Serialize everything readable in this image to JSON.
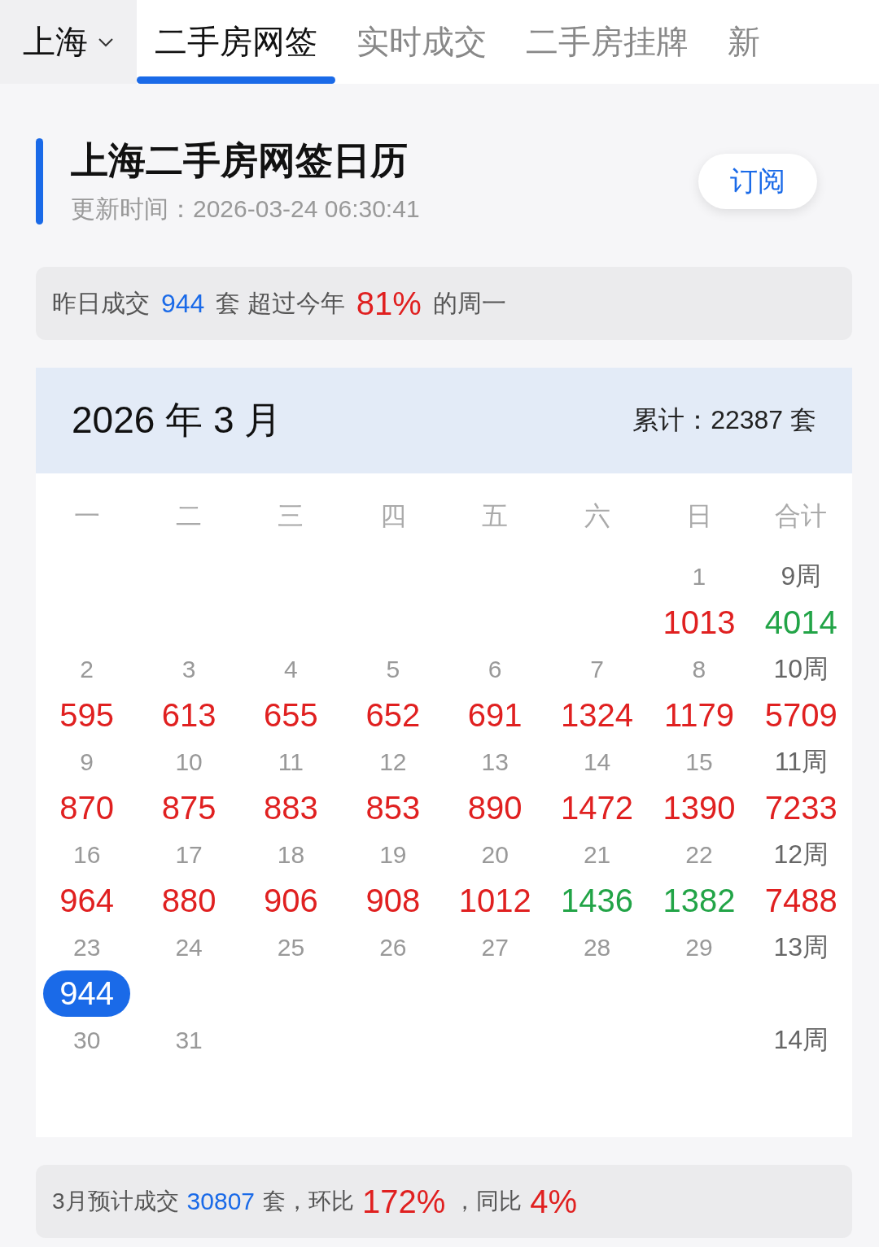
{
  "tabs": [
    {
      "label": "上海",
      "kind": "city",
      "selected": false
    },
    {
      "label": "二手房网签",
      "kind": "tab",
      "selected": true
    },
    {
      "label": "实时成交",
      "kind": "tab",
      "selected": false
    },
    {
      "label": "二手房挂牌",
      "kind": "tab",
      "selected": false
    },
    {
      "label": "新",
      "kind": "tab",
      "selected": false
    }
  ],
  "header": {
    "title": "上海二手房网签日历",
    "updated": "更新时间：2026-03-24 06:30:41",
    "subscribe": "订阅"
  },
  "summary": [
    {
      "text": "昨日成交",
      "kind": "plain"
    },
    {
      "text": "944",
      "kind": "count"
    },
    {
      "text": "套 超过今年",
      "kind": "plain"
    },
    {
      "text": "81%",
      "kind": "percent"
    },
    {
      "text": "的周一",
      "kind": "plain"
    }
  ],
  "calendar": {
    "month": "2026 年 3 月",
    "total": "累计：22387 套",
    "weekdays": [
      "一",
      "二",
      "三",
      "四",
      "五",
      "六",
      "日",
      "合计"
    ],
    "weeks": [
      {
        "kind": "first",
        "days": [
          {
            "date": "1",
            "value": "1013",
            "color": "#e02020",
            "selected": false
          }
        ],
        "week": {
          "label": "9周",
          "value": "4014",
          "color": "#22a447"
        }
      },
      {
        "kind": "full",
        "days": [
          {
            "date": "2",
            "value": "595",
            "color": "#e02020",
            "selected": false
          },
          {
            "date": "3",
            "value": "613",
            "color": "#e02020",
            "selected": false
          },
          {
            "date": "4",
            "value": "655",
            "color": "#e02020",
            "selected": false
          },
          {
            "date": "5",
            "value": "652",
            "color": "#e02020",
            "selected": false
          },
          {
            "date": "6",
            "value": "691",
            "color": "#e02020",
            "selected": false
          },
          {
            "date": "7",
            "value": "1324",
            "color": "#e02020",
            "selected": false
          },
          {
            "date": "8",
            "value": "1179",
            "color": "#e02020",
            "selected": false
          }
        ],
        "week": {
          "label": "10周",
          "value": "5709",
          "color": "#e02020"
        }
      },
      {
        "kind": "full",
        "days": [
          {
            "date": "9",
            "value": "870",
            "color": "#e02020",
            "selected": false
          },
          {
            "date": "10",
            "value": "875",
            "color": "#e02020",
            "selected": false
          },
          {
            "date": "11",
            "value": "883",
            "color": "#e02020",
            "selected": false
          },
          {
            "date": "12",
            "value": "853",
            "color": "#e02020",
            "selected": false
          },
          {
            "date": "13",
            "value": "890",
            "color": "#e02020",
            "selected": false
          },
          {
            "date": "14",
            "value": "1472",
            "color": "#e02020",
            "selected": false
          },
          {
            "date": "15",
            "value": "1390",
            "color": "#e02020",
            "selected": false
          }
        ],
        "week": {
          "label": "11周",
          "value": "7233",
          "color": "#e02020"
        }
      },
      {
        "kind": "full",
        "days": [
          {
            "date": "16",
            "value": "964",
            "color": "#e02020",
            "selected": false
          },
          {
            "date": "17",
            "value": "880",
            "color": "#e02020",
            "selected": false
          },
          {
            "date": "18",
            "value": "906",
            "color": "#e02020",
            "selected": false
          },
          {
            "date": "19",
            "value": "908",
            "color": "#e02020",
            "selected": false
          },
          {
            "date": "20",
            "value": "1012",
            "color": "#e02020",
            "selected": false
          },
          {
            "date": "21",
            "value": "1436",
            "color": "#22a447",
            "selected": false
          },
          {
            "date": "22",
            "value": "1382",
            "color": "#22a447",
            "selected": false
          }
        ],
        "week": {
          "label": "12周",
          "value": "7488",
          "color": "#e02020"
        }
      },
      {
        "kind": "full",
        "days": [
          {
            "date": "23",
            "value": "944",
            "selected": true
          },
          {
            "date": "24"
          },
          {
            "date": "25"
          },
          {
            "date": "26"
          },
          {
            "date": "27"
          },
          {
            "date": "28"
          },
          {
            "date": "29"
          }
        ],
        "week": {
          "label": "13周"
        }
      },
      {
        "kind": "last",
        "days": [
          {
            "date": "30"
          },
          {
            "date": "31"
          }
        ],
        "week": {
          "label": "14周"
        }
      }
    ]
  },
  "forecast": [
    {
      "text": "3月预计成交",
      "kind": "plain"
    },
    {
      "text": "30807",
      "kind": "count"
    },
    {
      "text": "套，环比",
      "kind": "plain"
    },
    {
      "text": "172%",
      "kind": "percent"
    },
    {
      "text": "，同比",
      "kind": "plain"
    },
    {
      "text": "4%",
      "kind": "percent"
    }
  ]
}
